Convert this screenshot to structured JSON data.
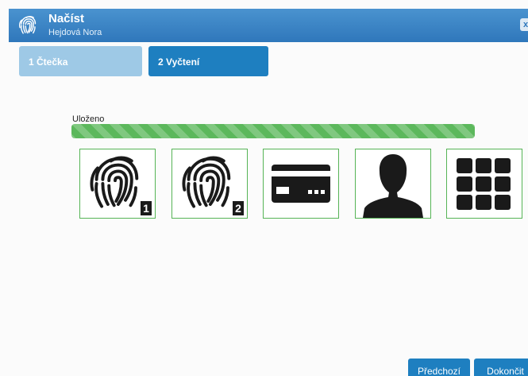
{
  "titlebar": {
    "title": "Načíst",
    "subtitle": "Hejdová Nora",
    "logo_icon": "fingerprint-icon",
    "close_label": "x"
  },
  "steps": [
    {
      "label": "1 Čtečka",
      "state": "done"
    },
    {
      "label": "2 Vyčtení",
      "state": "active"
    }
  ],
  "status": {
    "label": "Uloženo",
    "progress": 1.0,
    "color": "#5cb85c"
  },
  "tiles": [
    {
      "icon": "fingerprint-icon",
      "badge": "1"
    },
    {
      "icon": "fingerprint-icon",
      "badge": "2"
    },
    {
      "icon": "id-card-icon"
    },
    {
      "icon": "person-silhouette-icon"
    },
    {
      "icon": "keypad-grid-icon"
    }
  ],
  "buttons": {
    "previous": "Předchozí",
    "finish": "Dokončit"
  },
  "colors": {
    "titlebar": "#2f77bb",
    "step_done": "#9ec9e6",
    "step_active": "#1e7fc0",
    "tile_border": "#56b456",
    "button": "#1e7fc0"
  }
}
